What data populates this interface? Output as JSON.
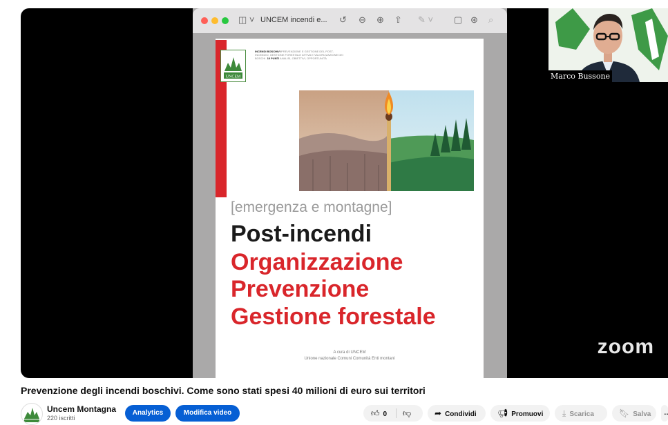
{
  "player": {
    "mac_window": {
      "title": "UNCEM incendi e...",
      "traffic_lights": [
        "#ff5f57",
        "#febc2e",
        "#28c840"
      ],
      "toolbar_icons": [
        "sidebar-icon",
        "rotate-icon",
        "zoom-out-icon",
        "zoom-in-icon",
        "share-icon",
        "markup-icon",
        "window-icon",
        "annotate-icon",
        "search-icon"
      ]
    },
    "document": {
      "logo_text": "UNCEM",
      "header_bold": "INCENDI BOSCHIVI",
      "header_text": "PREVENZIONE E GESTIONE DEL POST-INCENDIO, GESTIONE FORESTALE ATTIVA E VALORIZZAZIONE DEI BOSCHI.",
      "header_points": "10 PUNTI",
      "header_tail": "ANALISI, OBIETTIVI, OPPORTUNITÀ",
      "subtitle": "[emergenza e montagne]",
      "line1": "Post-incendi",
      "line2": "Organizzazione",
      "line3": "Prevenzione",
      "line4": "Gestione forestale",
      "credit1": "A cura di UNCEM",
      "credit2": "Unione nazionale Comuni Comunità Enti montani",
      "colors": {
        "red": "#d9262b",
        "dark": "#1a1a1a",
        "grey": "#9a9a9a"
      }
    },
    "speaker_name": "Marco Bussone",
    "zoom_watermark": "zoom"
  },
  "video": {
    "title": "Prevenzione degli incendi boschivi. Come sono stati spesi 40 milioni di euro sui territori"
  },
  "channel": {
    "name": "Uncem Montagna",
    "subscribers": "220 iscritti"
  },
  "actions": {
    "analytics": "Analytics",
    "edit_video": "Modifica video",
    "like_count": "0",
    "share": "Condividi",
    "promote": "Promuovi",
    "download": "Scarica",
    "save": "Salva",
    "more": "…"
  }
}
